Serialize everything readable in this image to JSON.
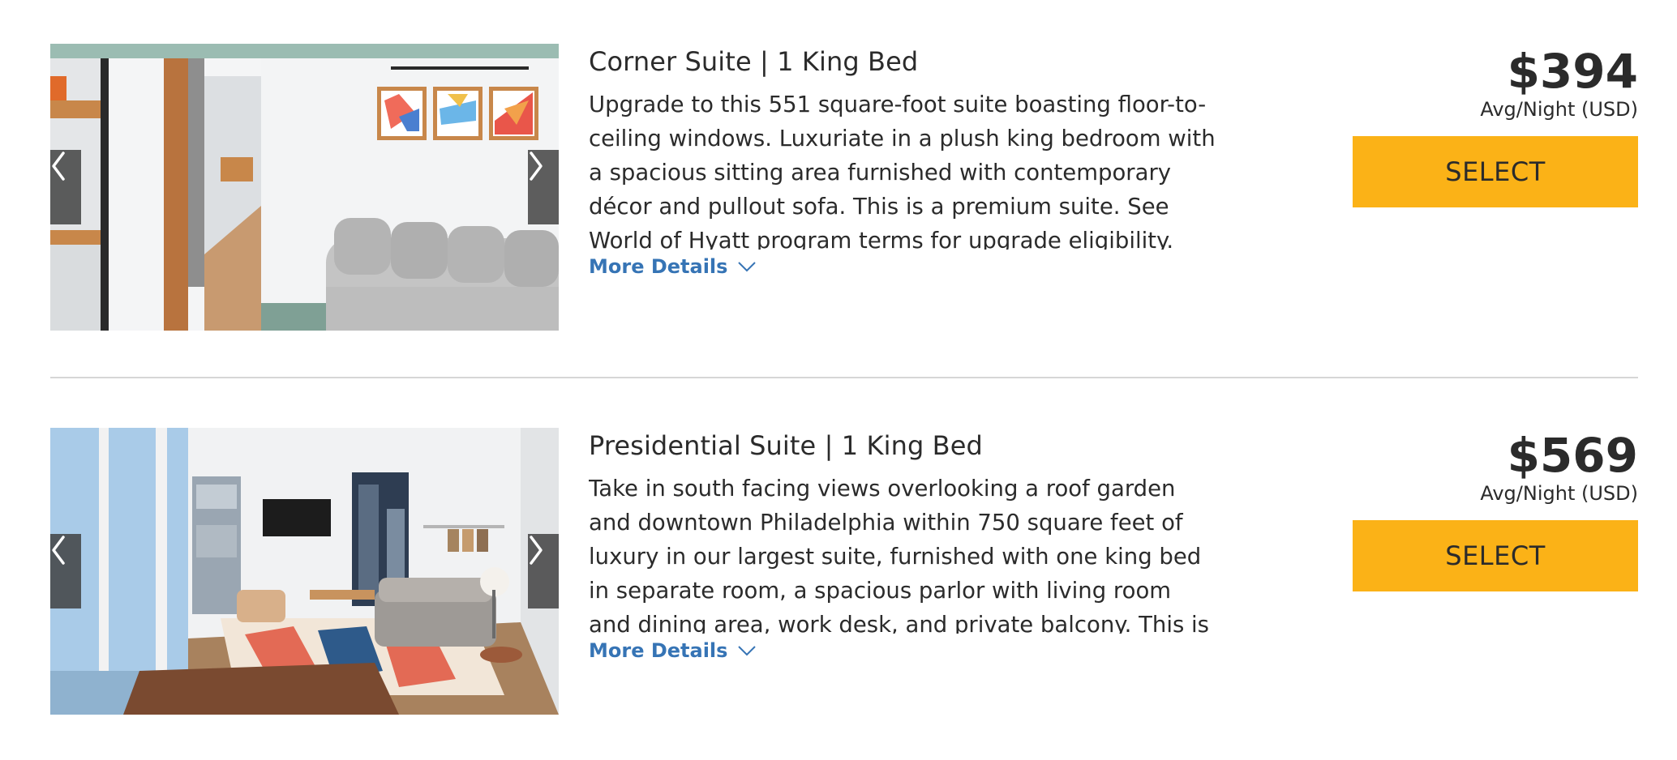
{
  "rooms": [
    {
      "title": "Corner Suite | 1 King Bed",
      "description": "Upgrade to this 551 square-foot suite boasting floor-to-ceiling windows. Luxuriate in a plush king bedroom with a spacious sitting area furnished with contemporary décor and pullout sofa.  This is a premium suite. See World of Hyatt program terms for upgrade eligibility.",
      "more_label": "More Details",
      "price": "$394",
      "price_unit": "Avg/Night (USD)",
      "select_label": "SELECT",
      "photo_alt": "corner-suite-living-room-photo"
    },
    {
      "title": "Presidential Suite | 1 King Bed",
      "description": "Take in south facing views overlooking a roof garden and downtown Philadelphia within 750 square feet of luxury in our largest suite, furnished with one king bed in separate room, a spacious parlor with living room and dining area, work desk, and private balcony. This is a premium suite.",
      "more_label": "More Details",
      "price": "$569",
      "price_unit": "Avg/Night (USD)",
      "select_label": "SELECT",
      "photo_alt": "presidential-suite-parlor-photo"
    }
  ],
  "icons": {
    "prev": "chevron-left-icon",
    "next": "chevron-right-icon",
    "expand": "chevron-down-icon"
  },
  "colors": {
    "accent_button": "#fbb217",
    "link": "#3674b5",
    "text": "#2b2b2b",
    "divider": "#d6d6d6"
  }
}
